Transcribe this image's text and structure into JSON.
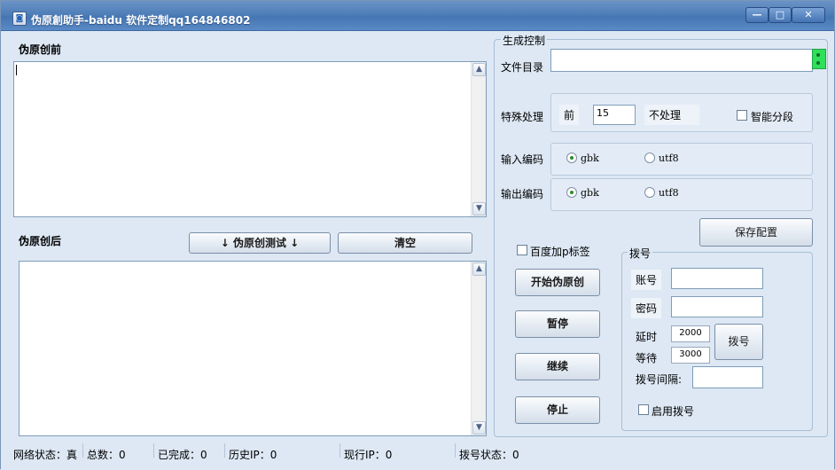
{
  "window": {
    "title": "伪原創助手-baidu 软件定制qq164846802",
    "icon": "app-icon"
  },
  "left": {
    "before_label": "伪原创前",
    "after_label": "伪原创后",
    "before_text": "",
    "after_text": "",
    "test_button": "↓ 伪原创测试 ↓",
    "clear_button": "清空"
  },
  "generate": {
    "group_title": "生成控制",
    "dir_label": "文件目录",
    "dir_value": "",
    "special_label": "特殊处理",
    "front_label": "前",
    "front_value": "15",
    "no_process_label": "不处理",
    "smart_split_label": "智能分段",
    "smart_split_checked": false,
    "input_encoding_label": "输入编码",
    "output_encoding_label": "输出编码",
    "encodings": [
      "gbk",
      "utf8"
    ],
    "input_encoding_selected": "gbk",
    "output_encoding_selected": "gbk",
    "save_config": "保存配置"
  },
  "actions": {
    "baidu_tag_label": "百度加p标签",
    "baidu_tag_checked": false,
    "start": "开始伪原创",
    "pause": "暂停",
    "resume": "继续",
    "stop": "停止"
  },
  "dialup": {
    "group_title": "拨号",
    "account_label": "账号",
    "account_value": "",
    "password_label": "密码",
    "password_value": "",
    "delay_label": "延时",
    "delay_value": "2000",
    "wait_label": "等待",
    "wait_value": "3000",
    "dial_button": "拨号",
    "interval_label": "拨号间隔:",
    "interval_value": "",
    "enable_label": "启用拨号",
    "enable_checked": false
  },
  "status": {
    "network": "网络状态：真",
    "total": "总数：0",
    "done": "已完成：0",
    "history_ip": "历史IP：0",
    "current_ip": "现行IP：0",
    "dial_status": "拨号状态：0"
  },
  "colors": {
    "titlebar": "#4f7eb8",
    "window_bg": "#dde8f4",
    "indicator": "#2ee05a"
  }
}
